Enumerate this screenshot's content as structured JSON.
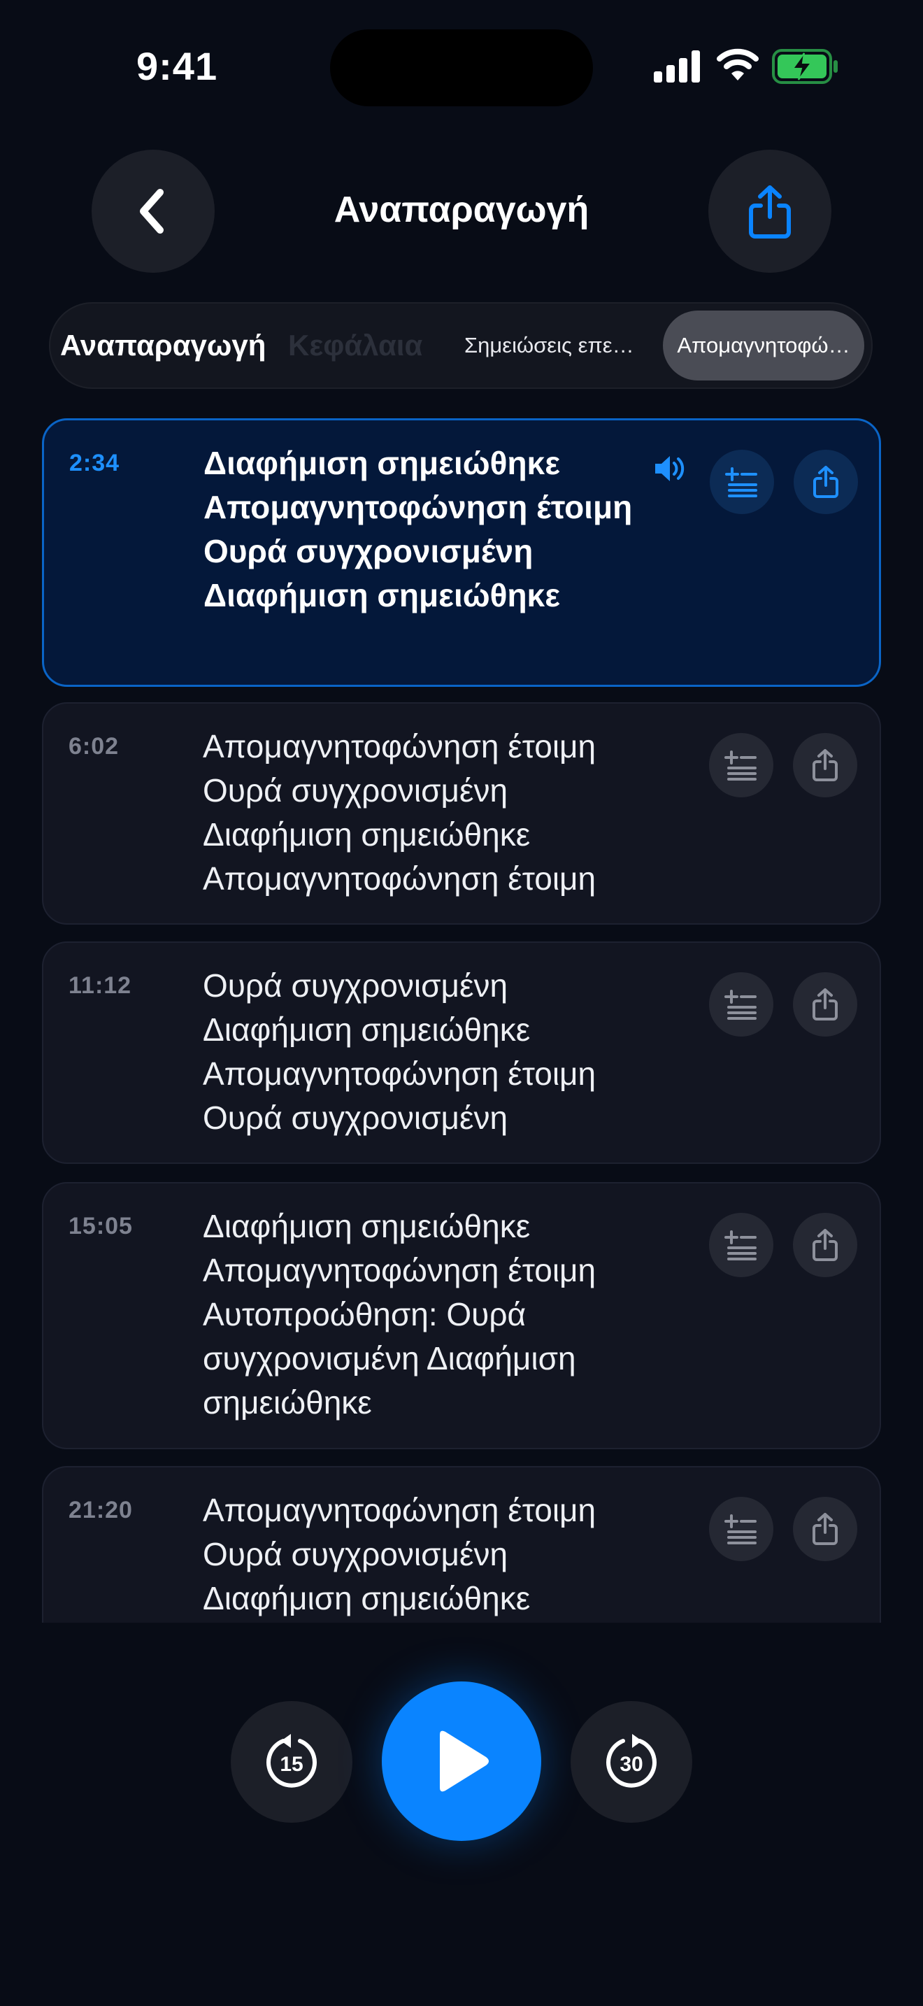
{
  "status_bar": {
    "time": "9:41"
  },
  "nav": {
    "title": "Αναπαραγωγή"
  },
  "tabs": [
    {
      "label": "Αναπαραγωγή"
    },
    {
      "label": "Κεφάλαια"
    },
    {
      "label": "Σημειώσεις επε…"
    },
    {
      "label": "Απομαγνητοφώ…"
    }
  ],
  "segments": [
    {
      "time": "2:34",
      "text": "Διαφήμιση σημειώθηκε Απομαγνητοφώνηση έτοιμη Ουρά συγχρονισμένη Διαφήμιση σημειώθηκε",
      "active": true
    },
    {
      "time": "6:02",
      "text": "Απομαγνητοφώνηση έτοιμη Ουρά συγχρονισμένη Διαφήμιση σημειώθηκε Απομαγνητοφώνηση έτοιμη",
      "active": false
    },
    {
      "time": "11:12",
      "text": "Ουρά συγχρονισμένη Διαφήμιση σημειώθηκε Απομαγνητοφώνηση έτοιμη Ουρά συγχρονισμένη",
      "active": false
    },
    {
      "time": "15:05",
      "text": "Διαφήμιση σημειώθηκε Απομαγνητοφώνηση έτοιμη Αυτοπροώθηση: Ουρά συγχρονισμένη Διαφήμιση σημειώθηκε",
      "active": false
    },
    {
      "time": "21:20",
      "text": "Απομαγνητοφώνηση έτοιμη Ουρά συγχρονισμένη Διαφήμιση σημειώθηκε",
      "active": false
    }
  ],
  "player": {
    "skip_back": "15",
    "skip_forward": "30"
  },
  "colors": {
    "accent": "#0a84ff",
    "background": "#080c16",
    "battery": "#34c759"
  }
}
